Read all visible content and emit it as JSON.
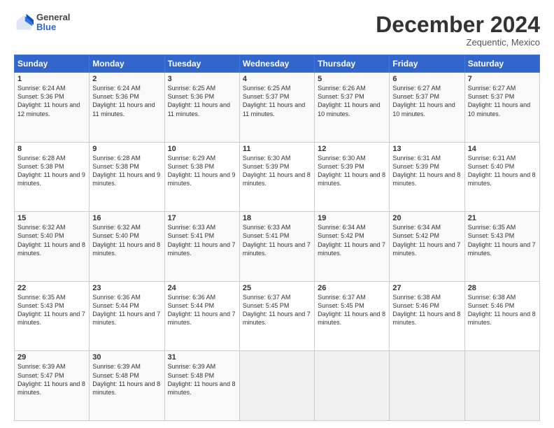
{
  "header": {
    "logo_line1": "General",
    "logo_line2": "Blue",
    "month_title": "December 2024",
    "location": "Zequentic, Mexico"
  },
  "days_of_week": [
    "Sunday",
    "Monday",
    "Tuesday",
    "Wednesday",
    "Thursday",
    "Friday",
    "Saturday"
  ],
  "weeks": [
    [
      {
        "day": "1",
        "sunrise": "6:24 AM",
        "sunset": "5:36 PM",
        "daylight": "11 hours and 12 minutes."
      },
      {
        "day": "2",
        "sunrise": "6:24 AM",
        "sunset": "5:36 PM",
        "daylight": "11 hours and 11 minutes."
      },
      {
        "day": "3",
        "sunrise": "6:25 AM",
        "sunset": "5:36 PM",
        "daylight": "11 hours and 11 minutes."
      },
      {
        "day": "4",
        "sunrise": "6:25 AM",
        "sunset": "5:37 PM",
        "daylight": "11 hours and 11 minutes."
      },
      {
        "day": "5",
        "sunrise": "6:26 AM",
        "sunset": "5:37 PM",
        "daylight": "11 hours and 10 minutes."
      },
      {
        "day": "6",
        "sunrise": "6:27 AM",
        "sunset": "5:37 PM",
        "daylight": "11 hours and 10 minutes."
      },
      {
        "day": "7",
        "sunrise": "6:27 AM",
        "sunset": "5:37 PM",
        "daylight": "11 hours and 10 minutes."
      }
    ],
    [
      {
        "day": "8",
        "sunrise": "6:28 AM",
        "sunset": "5:38 PM",
        "daylight": "11 hours and 9 minutes."
      },
      {
        "day": "9",
        "sunrise": "6:28 AM",
        "sunset": "5:38 PM",
        "daylight": "11 hours and 9 minutes."
      },
      {
        "day": "10",
        "sunrise": "6:29 AM",
        "sunset": "5:38 PM",
        "daylight": "11 hours and 9 minutes."
      },
      {
        "day": "11",
        "sunrise": "6:30 AM",
        "sunset": "5:39 PM",
        "daylight": "11 hours and 8 minutes."
      },
      {
        "day": "12",
        "sunrise": "6:30 AM",
        "sunset": "5:39 PM",
        "daylight": "11 hours and 8 minutes."
      },
      {
        "day": "13",
        "sunrise": "6:31 AM",
        "sunset": "5:39 PM",
        "daylight": "11 hours and 8 minutes."
      },
      {
        "day": "14",
        "sunrise": "6:31 AM",
        "sunset": "5:40 PM",
        "daylight": "11 hours and 8 minutes."
      }
    ],
    [
      {
        "day": "15",
        "sunrise": "6:32 AM",
        "sunset": "5:40 PM",
        "daylight": "11 hours and 8 minutes."
      },
      {
        "day": "16",
        "sunrise": "6:32 AM",
        "sunset": "5:40 PM",
        "daylight": "11 hours and 8 minutes."
      },
      {
        "day": "17",
        "sunrise": "6:33 AM",
        "sunset": "5:41 PM",
        "daylight": "11 hours and 7 minutes."
      },
      {
        "day": "18",
        "sunrise": "6:33 AM",
        "sunset": "5:41 PM",
        "daylight": "11 hours and 7 minutes."
      },
      {
        "day": "19",
        "sunrise": "6:34 AM",
        "sunset": "5:42 PM",
        "daylight": "11 hours and 7 minutes."
      },
      {
        "day": "20",
        "sunrise": "6:34 AM",
        "sunset": "5:42 PM",
        "daylight": "11 hours and 7 minutes."
      },
      {
        "day": "21",
        "sunrise": "6:35 AM",
        "sunset": "5:43 PM",
        "daylight": "11 hours and 7 minutes."
      }
    ],
    [
      {
        "day": "22",
        "sunrise": "6:35 AM",
        "sunset": "5:43 PM",
        "daylight": "11 hours and 7 minutes."
      },
      {
        "day": "23",
        "sunrise": "6:36 AM",
        "sunset": "5:44 PM",
        "daylight": "11 hours and 7 minutes."
      },
      {
        "day": "24",
        "sunrise": "6:36 AM",
        "sunset": "5:44 PM",
        "daylight": "11 hours and 7 minutes."
      },
      {
        "day": "25",
        "sunrise": "6:37 AM",
        "sunset": "5:45 PM",
        "daylight": "11 hours and 7 minutes."
      },
      {
        "day": "26",
        "sunrise": "6:37 AM",
        "sunset": "5:45 PM",
        "daylight": "11 hours and 8 minutes."
      },
      {
        "day": "27",
        "sunrise": "6:38 AM",
        "sunset": "5:46 PM",
        "daylight": "11 hours and 8 minutes."
      },
      {
        "day": "28",
        "sunrise": "6:38 AM",
        "sunset": "5:46 PM",
        "daylight": "11 hours and 8 minutes."
      }
    ],
    [
      {
        "day": "29",
        "sunrise": "6:39 AM",
        "sunset": "5:47 PM",
        "daylight": "11 hours and 8 minutes."
      },
      {
        "day": "30",
        "sunrise": "6:39 AM",
        "sunset": "5:48 PM",
        "daylight": "11 hours and 8 minutes."
      },
      {
        "day": "31",
        "sunrise": "6:39 AM",
        "sunset": "5:48 PM",
        "daylight": "11 hours and 8 minutes."
      },
      null,
      null,
      null,
      null
    ]
  ]
}
